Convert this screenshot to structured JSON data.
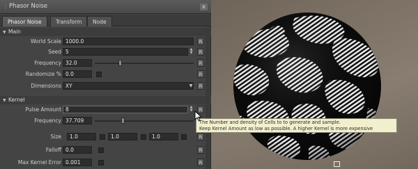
{
  "window": {
    "title": "Phasor Noise",
    "close_glyph": "x"
  },
  "tabs": [
    {
      "label": "Phasor Noise"
    },
    {
      "label": "Transform"
    },
    {
      "label": "Node"
    }
  ],
  "main": {
    "title": "Main",
    "fields": {
      "world_scale": {
        "label": "World Scale",
        "value": "1000.0"
      },
      "seed": {
        "label": "Seed",
        "value": "5"
      },
      "frequency": {
        "label": "Frequency",
        "value": "32.0",
        "slider_fraction": 0.25
      },
      "randomize": {
        "label": "Randomize %",
        "value": "0.0"
      },
      "dimensions": {
        "label": "Dimensions",
        "value": "XY"
      }
    }
  },
  "kernel": {
    "title": "Kernel",
    "fields": {
      "pulse_amount": {
        "label": "Pulse Amount",
        "value": "8"
      },
      "frequency": {
        "label": "Frequency",
        "value": "37.709",
        "slider_fraction": 0.28
      },
      "size": {
        "label": "Size",
        "values": [
          "1.0",
          "1.0",
          "1.0"
        ]
      },
      "falloff": {
        "label": "Falloff",
        "value": "0.0"
      },
      "max_kernel_error": {
        "label": "Max Kernel Error",
        "value": "0.001"
      }
    }
  },
  "reset_label": "R",
  "tooltip": {
    "line1": "The Number and density of Cells to to generate and sample.",
    "line2": "Keep Kernel Amount as low as possible. A higher Kernel is more expensive"
  },
  "colors": {
    "panel_bg": "#444444",
    "field_bg": "#2d2d2d",
    "tooltip_bg": "#f2efcf"
  }
}
